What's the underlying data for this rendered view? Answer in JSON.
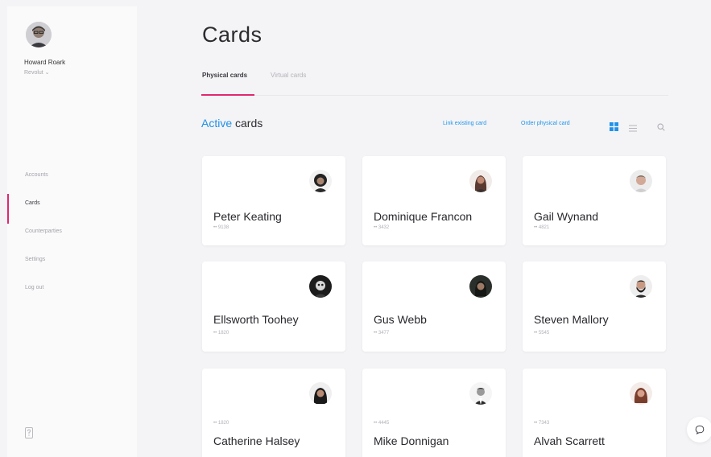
{
  "sidebar": {
    "user_name": "Howard Roark",
    "org": "Revolut ⌄",
    "items": [
      {
        "label": "Accounts"
      },
      {
        "label": "Cards"
      },
      {
        "label": "Counterparties"
      },
      {
        "label": "Settings"
      },
      {
        "label": "Log out"
      }
    ],
    "active_item": "Cards"
  },
  "page": {
    "title": "Cards"
  },
  "tabs": {
    "physical": "Physical cards",
    "virtual": "Virtual cards"
  },
  "section": {
    "accent": "Active",
    "rest": " cards"
  },
  "toolbar": {
    "link_existing": "Link existing card",
    "order_physical": "Order physical card"
  },
  "cards": [
    {
      "name": "Peter Keating",
      "number": "•• 9138"
    },
    {
      "name": "Dominique Francon",
      "number": "•• 3432"
    },
    {
      "name": "Gail Wynand",
      "number": "•• 4821"
    },
    {
      "name": "Ellsworth Toohey",
      "number": "•• 1820"
    },
    {
      "name": "Gus Webb",
      "number": "•• 3477"
    },
    {
      "name": "Steven Mallory",
      "number": "•• 5545"
    },
    {
      "name": "Catherine Halsey",
      "number": "•• 1820"
    },
    {
      "name": "Mike Donnigan",
      "number": "•• 4445"
    },
    {
      "name": "Alvah Scarrett",
      "number": "•• 7343"
    }
  ],
  "colors": {
    "accent_pink": "#e0286e",
    "accent_blue": "#1f91e8"
  }
}
